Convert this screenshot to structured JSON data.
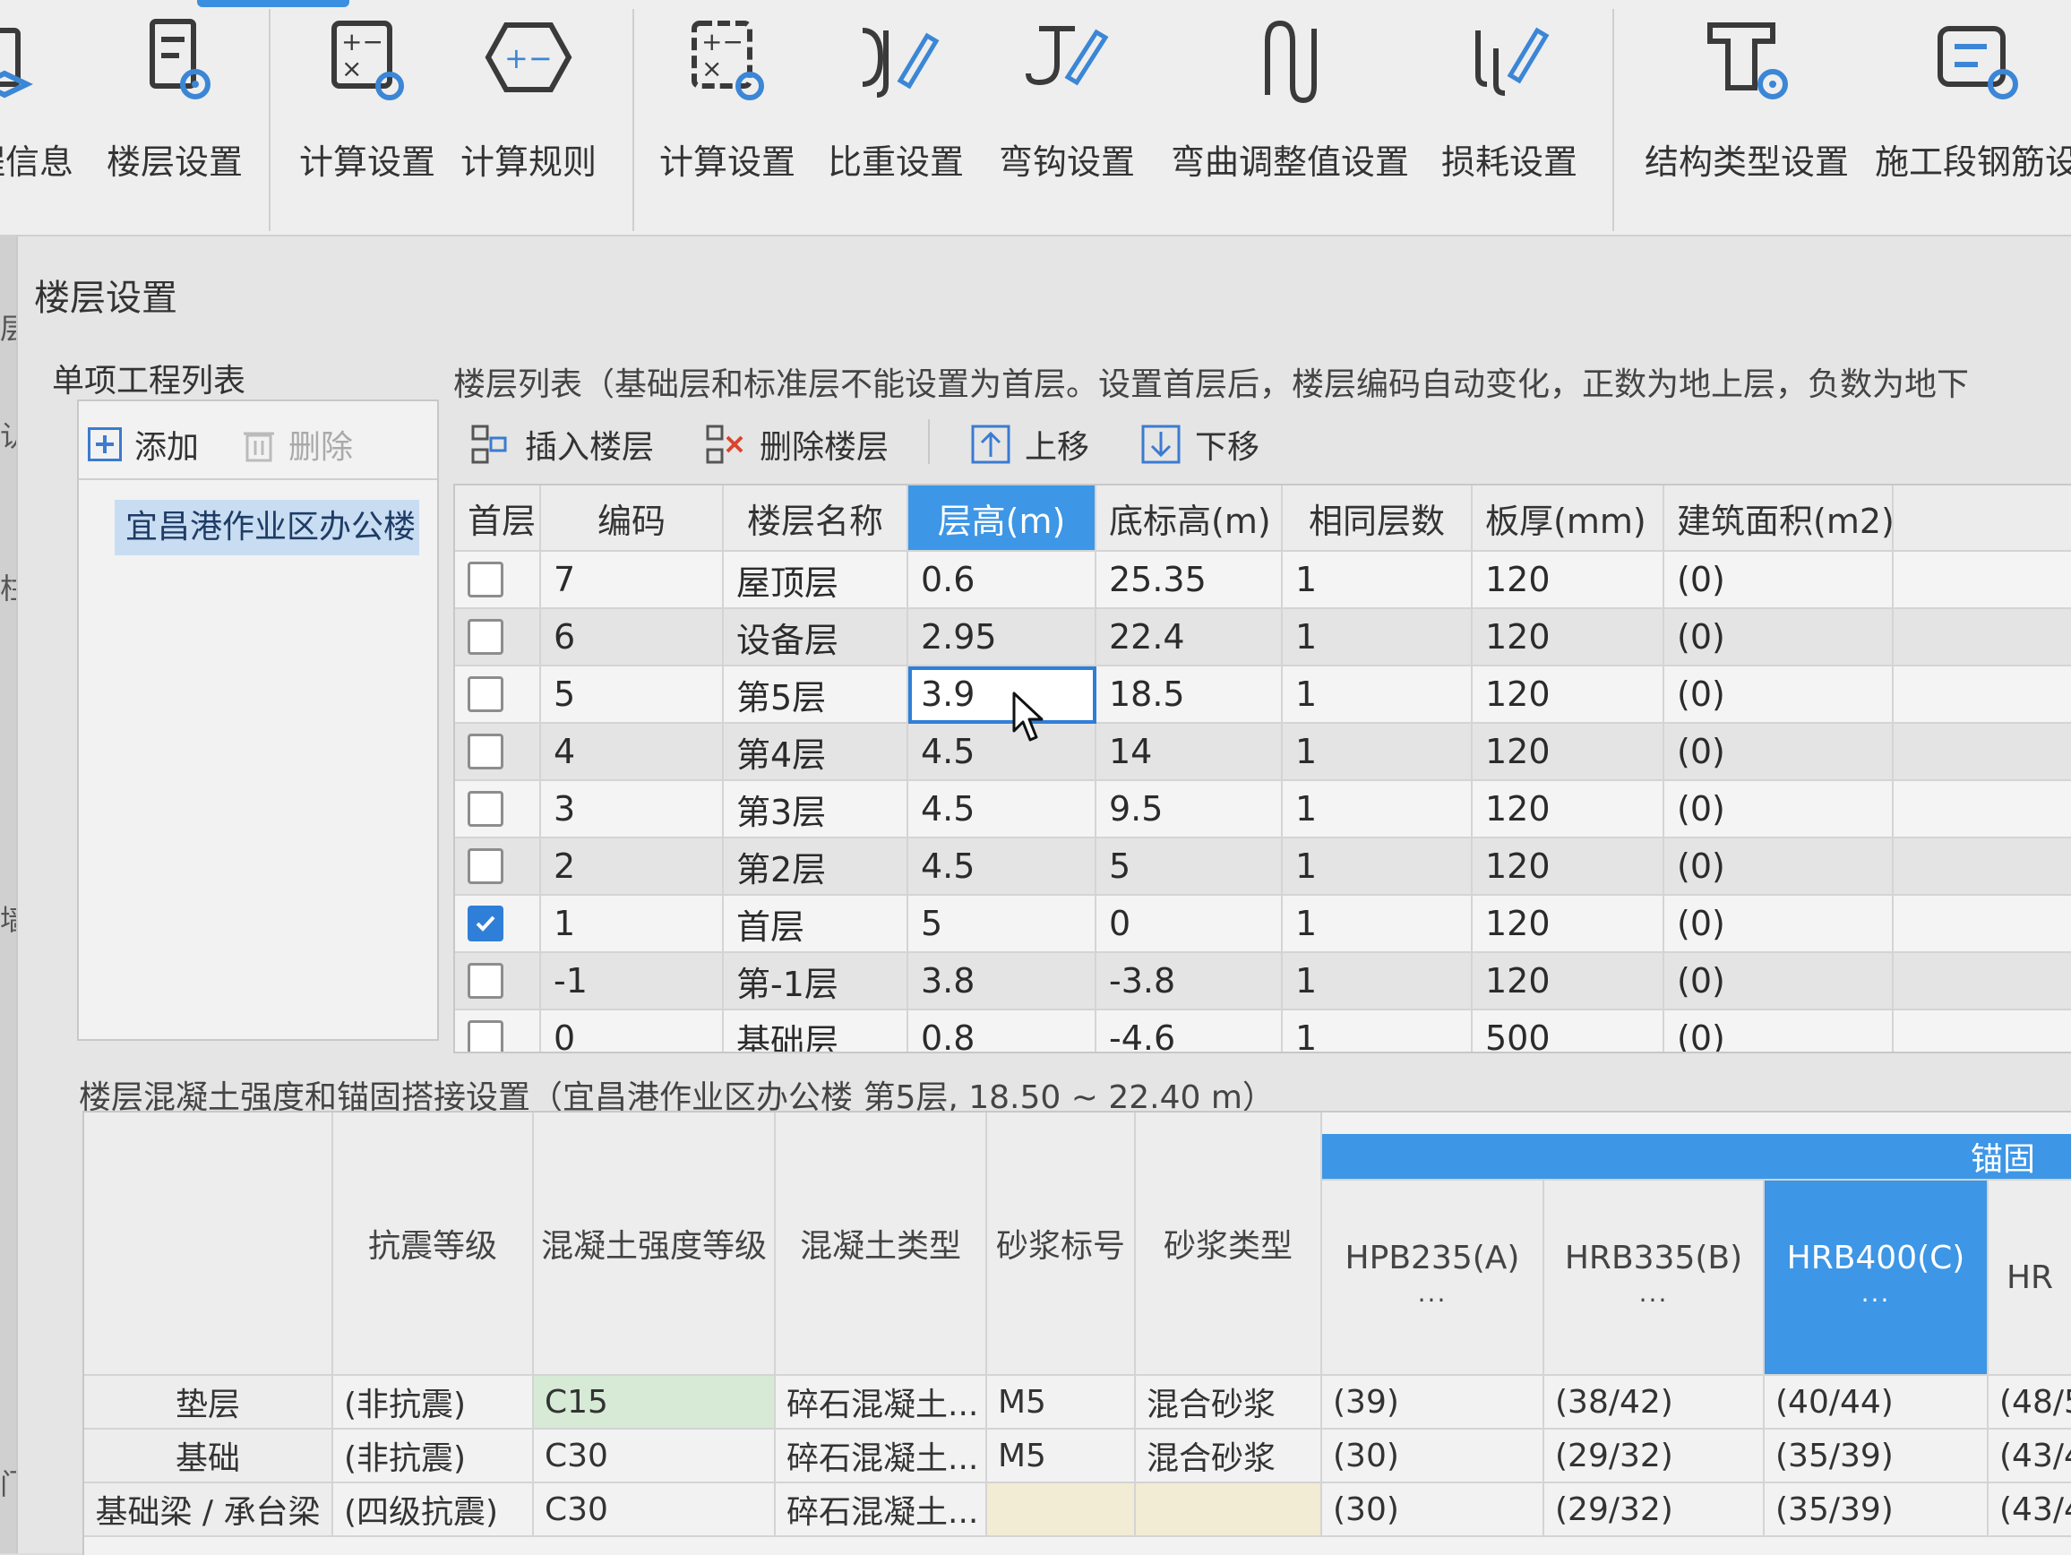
{
  "ribbon": {
    "buttons": [
      {
        "label": "程信息",
        "icon": "project-info-icon"
      },
      {
        "label": "楼层设置",
        "icon": "floor-settings-icon"
      },
      {
        "label": "计算设置",
        "icon": "calc-settings-icon"
      },
      {
        "label": "计算规则",
        "icon": "calc-rules-icon"
      },
      {
        "label": "计算设置",
        "icon": "calc-settings-icon"
      },
      {
        "label": "比重设置",
        "icon": "density-settings-icon"
      },
      {
        "label": "弯钩设置",
        "icon": "hook-settings-icon"
      },
      {
        "label": "弯曲调整值设置",
        "icon": "bend-adjust-icon"
      },
      {
        "label": "损耗设置",
        "icon": "loss-settings-icon"
      },
      {
        "label": "结构类型设置",
        "icon": "structure-type-icon"
      },
      {
        "label": "施工段钢筋设",
        "icon": "construction-rebar-icon"
      }
    ]
  },
  "dialog": {
    "title": "楼层设置",
    "left_edge": [
      "层",
      "认",
      "柱",
      "墙",
      "门"
    ],
    "project_list": {
      "title": "单项工程列表",
      "add_label": "添加",
      "delete_label": "删除",
      "items": [
        "宜昌港作业区办公楼"
      ]
    },
    "floor_list": {
      "caption": "楼层列表（基础层和标准层不能设置为首层。设置首层后，楼层编码自动变化，正数为地上层，负数为地下",
      "toolbar": {
        "insert": "插入楼层",
        "delete": "删除楼层",
        "move_up": "上移",
        "move_down": "下移"
      },
      "columns": [
        "首层",
        "编码",
        "楼层名称",
        "层高(m)",
        "底标高(m)",
        "相同层数",
        "板厚(mm)",
        "建筑面积(m2)"
      ],
      "active_column": "层高(m)",
      "rows": [
        {
          "first": false,
          "code": "7",
          "name": "屋顶层",
          "height": "0.6",
          "base": "25.35",
          "same": "1",
          "slab": "120",
          "area": "(0)"
        },
        {
          "first": false,
          "code": "6",
          "name": "设备层",
          "height": "2.95",
          "base": "22.4",
          "same": "1",
          "slab": "120",
          "area": "(0)"
        },
        {
          "first": false,
          "code": "5",
          "name": "第5层",
          "height": "3.9",
          "base": "18.5",
          "same": "1",
          "slab": "120",
          "area": "(0)"
        },
        {
          "first": false,
          "code": "4",
          "name": "第4层",
          "height": "4.5",
          "base": "14",
          "same": "1",
          "slab": "120",
          "area": "(0)"
        },
        {
          "first": false,
          "code": "3",
          "name": "第3层",
          "height": "4.5",
          "base": "9.5",
          "same": "1",
          "slab": "120",
          "area": "(0)"
        },
        {
          "first": false,
          "code": "2",
          "name": "第2层",
          "height": "4.5",
          "base": "5",
          "same": "1",
          "slab": "120",
          "area": "(0)"
        },
        {
          "first": true,
          "code": "1",
          "name": "首层",
          "height": "5",
          "base": "0",
          "same": "1",
          "slab": "120",
          "area": "(0)"
        },
        {
          "first": false,
          "code": "-1",
          "name": "第-1层",
          "height": "3.8",
          "base": "-3.8",
          "same": "1",
          "slab": "120",
          "area": "(0)"
        },
        {
          "first": false,
          "code": "0",
          "name": "基础层",
          "height": "0.8",
          "base": "-4.6",
          "same": "1",
          "slab": "500",
          "area": "(0)"
        }
      ]
    },
    "concrete": {
      "caption": "楼层混凝土强度和锚固搭接设置（宜昌港作业区办公楼  第5层, 18.50 ~ 22.40 m）",
      "group_header": "锚固",
      "columns": [
        "抗震等级",
        "混凝土强度等级",
        "混凝土类型",
        "砂浆标号",
        "砂浆类型",
        "HPB235(A)",
        "HRB335(B)",
        "HRB400(C)",
        "HR"
      ],
      "dots": "···",
      "rows": [
        {
          "name": "垫层",
          "seismic": "(非抗震)",
          "grade": "C15",
          "ctype": "碎石混凝土...",
          "mortar": "M5",
          "mtype": "混合砂浆",
          "a": "(39)",
          "b": "(38/42)",
          "c": "(40/44)",
          "d": "(48/5"
        },
        {
          "name": "基础",
          "seismic": "(非抗震)",
          "grade": "C30",
          "ctype": "碎石混凝土...",
          "mortar": "M5",
          "mtype": "混合砂浆",
          "a": "(30)",
          "b": "(29/32)",
          "c": "(35/39)",
          "d": "(43/4"
        },
        {
          "name": "基础梁 / 承台梁",
          "seismic": "(四级抗震)",
          "grade": "C30",
          "ctype": "碎石混凝土...",
          "mortar": "",
          "mtype": "",
          "a": "(30)",
          "b": "(29/32)",
          "c": "(35/39)",
          "d": "(43/4"
        }
      ]
    }
  },
  "colors": {
    "accent": "#3d96e6",
    "selection": "#c8ddf2",
    "green_cell": "#d6ead6"
  }
}
